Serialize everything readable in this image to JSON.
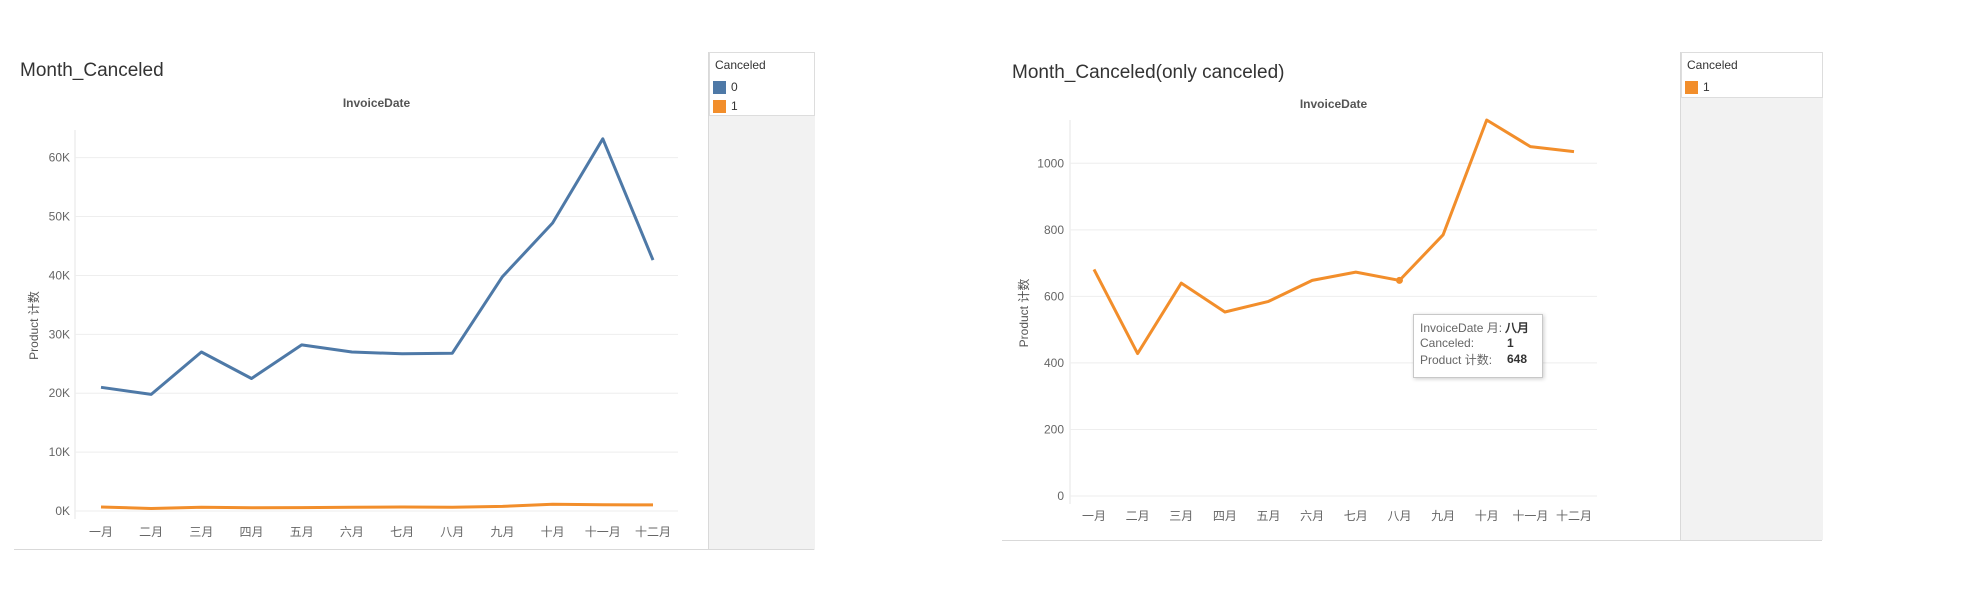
{
  "colors": {
    "series_0": "#4e79a7",
    "series_1": "#f28e2b",
    "grid": "#eeeeee",
    "axis_text": "#666666"
  },
  "left": {
    "title": "Month_Canceled",
    "legend": {
      "header": "Canceled",
      "items": [
        {
          "label": "0",
          "color": "#4e79a7"
        },
        {
          "label": "1",
          "color": "#f28e2b"
        }
      ]
    }
  },
  "right": {
    "title": "Month_Canceled(only canceled)",
    "legend": {
      "header": "Canceled",
      "items": [
        {
          "label": "1",
          "color": "#f28e2b"
        }
      ]
    },
    "tooltip": {
      "rows": [
        {
          "key": "InvoiceDate 月:",
          "value": "八月"
        },
        {
          "key": "Canceled:",
          "value": "1"
        },
        {
          "key": "Product 计数:",
          "value": "648"
        }
      ]
    }
  },
  "chart_data": [
    {
      "type": "line",
      "title": "Month_Canceled",
      "top_label": "InvoiceDate",
      "ylabel": "Product 计数",
      "categories": [
        "一月",
        "二月",
        "三月",
        "四月",
        "五月",
        "六月",
        "七月",
        "八月",
        "九月",
        "十月",
        "十一月",
        "十二月"
      ],
      "ylim": [
        0,
        63000
      ],
      "yticks": [
        0,
        10000,
        20000,
        30000,
        40000,
        50000,
        60000
      ],
      "ytick_labels": [
        "0K",
        "10K",
        "20K",
        "30K",
        "40K",
        "50K",
        "60K"
      ],
      "grid": true,
      "legend_position": "right",
      "series": [
        {
          "name": "0",
          "color": "#4e79a7",
          "values": [
            21000,
            19800,
            27000,
            22500,
            28200,
            27000,
            26700,
            26800,
            39800,
            48900,
            63200,
            42600
          ]
        },
        {
          "name": "1",
          "color": "#f28e2b",
          "values": [
            681,
            428,
            640,
            553,
            585,
            648,
            673,
            648,
            785,
            1130,
            1050,
            1035
          ]
        }
      ]
    },
    {
      "type": "line",
      "title": "Month_Canceled(only canceled)",
      "top_label": "InvoiceDate",
      "ylabel": "Product 计数",
      "categories": [
        "一月",
        "二月",
        "三月",
        "四月",
        "五月",
        "六月",
        "七月",
        "八月",
        "九月",
        "十月",
        "十一月",
        "十二月"
      ],
      "ylim": [
        0,
        1100
      ],
      "yticks": [
        0,
        200,
        400,
        600,
        800,
        1000
      ],
      "ytick_labels": [
        "0",
        "200",
        "400",
        "600",
        "800",
        "1000"
      ],
      "grid": true,
      "legend_position": "right",
      "series": [
        {
          "name": "1",
          "color": "#f28e2b",
          "values": [
            681,
            428,
            640,
            553,
            585,
            648,
            673,
            648,
            785,
            1130,
            1050,
            1035
          ]
        }
      ],
      "highlight": {
        "category": "八月",
        "value": 648
      }
    }
  ]
}
